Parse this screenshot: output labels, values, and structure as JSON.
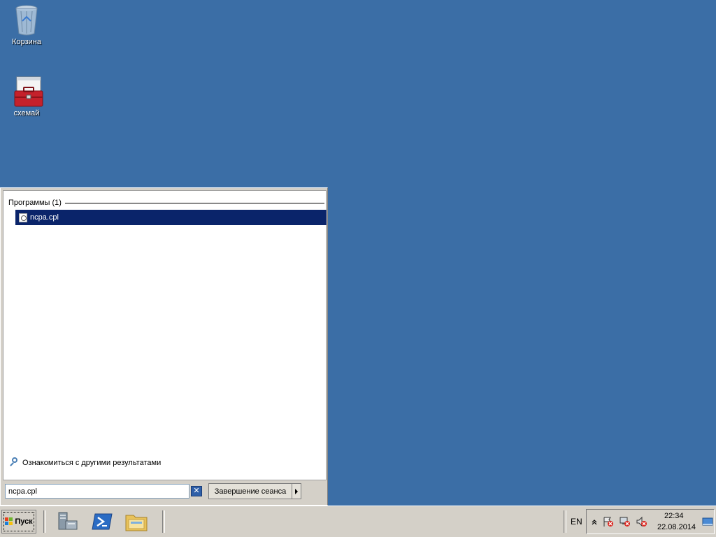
{
  "desktop": {
    "icons": [
      {
        "label": "Корзина",
        "icon": "recycle-bin-icon"
      },
      {
        "label": "схемай",
        "icon": "toolbox-icon"
      }
    ]
  },
  "start_menu": {
    "group_header": "Программы (1)",
    "results": [
      {
        "label": "ncpa.cpl",
        "icon": "control-panel-file-icon"
      }
    ],
    "more_results": "Ознакомиться с другими результатами",
    "search": {
      "value": "ncpa.cpl"
    },
    "clear_label": "✕",
    "logoff_label": "Завершение сеанса"
  },
  "taskbar": {
    "start_label": "Пуск",
    "pinned": [
      "server-manager-icon",
      "powershell-icon",
      "explorer-icon"
    ],
    "tray": {
      "language": "EN",
      "time": "22:34",
      "date": "22.08.2014"
    }
  },
  "colors": {
    "desktop_bg": "#3b6ea6",
    "selection": "#0a246a",
    "chrome": "#d4d0c8"
  }
}
